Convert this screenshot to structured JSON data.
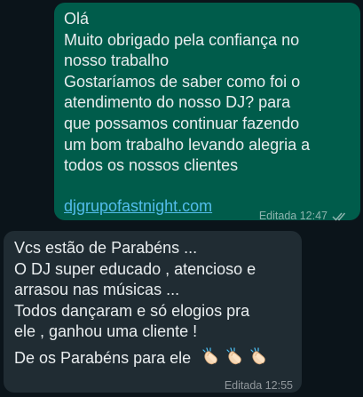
{
  "outgoing": {
    "lines": [
      "Olá",
      "Muito obrigado pela confiança no",
      "nosso trabalho",
      "Gostaríamos de saber como foi o",
      "atendimento do nosso DJ? para",
      "que possamos continuar fazendo",
      "um bom trabalho levando alegria a",
      "todos os nossos clientes"
    ],
    "link": "djgrupofastnight.com",
    "meta": "Editada 12:47",
    "ticks_icon": "double-check-icon"
  },
  "incoming": {
    "lines": [
      "Vcs estão de Parabéns ...",
      "O DJ super educado , atencioso e",
      "arrasou nas músicas ...",
      "Todos dançaram e só elogios pra",
      "ele , ganhou uma cliente !",
      "De os Parabéns para ele"
    ],
    "emoji": [
      "clapping-hands",
      "clapping-hands",
      "clapping-hands"
    ],
    "meta": "Editada 12:55"
  }
}
